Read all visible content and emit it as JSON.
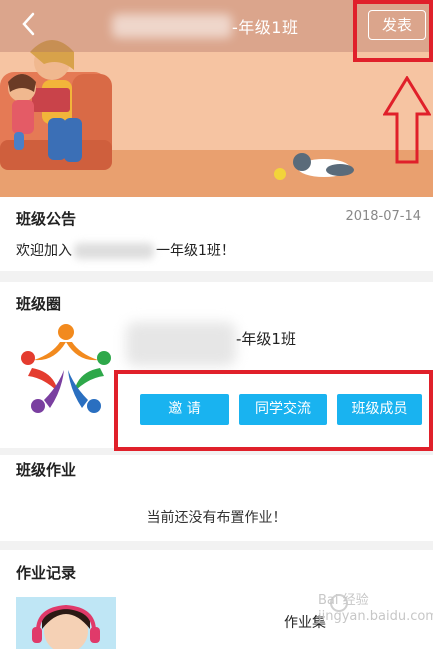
{
  "header": {
    "back_icon": "chevron-left-icon",
    "title": "-年级1班",
    "post_label": "发表"
  },
  "notice": {
    "heading": "班级公告",
    "date": "2018-07-14",
    "text_prefix": "欢迎加入",
    "text_suffix": "一年级1班！"
  },
  "circle": {
    "heading": "班级圈",
    "name": "-年级1班",
    "buttons": [
      "邀 请",
      "同学交流",
      "班级成员"
    ]
  },
  "homework": {
    "heading": "班级作业",
    "empty_text": "当前还没有布置作业！"
  },
  "records": {
    "heading": "作业记录",
    "label": "作业集"
  },
  "watermark": {
    "line1": "Bai 经验",
    "line2": "jingyan.baidu.com"
  },
  "colors": {
    "accent": "#19b3f0",
    "highlight": "#e0202a",
    "banner_wall": "#f6c4a2",
    "banner_floor": "#e9a06f"
  }
}
